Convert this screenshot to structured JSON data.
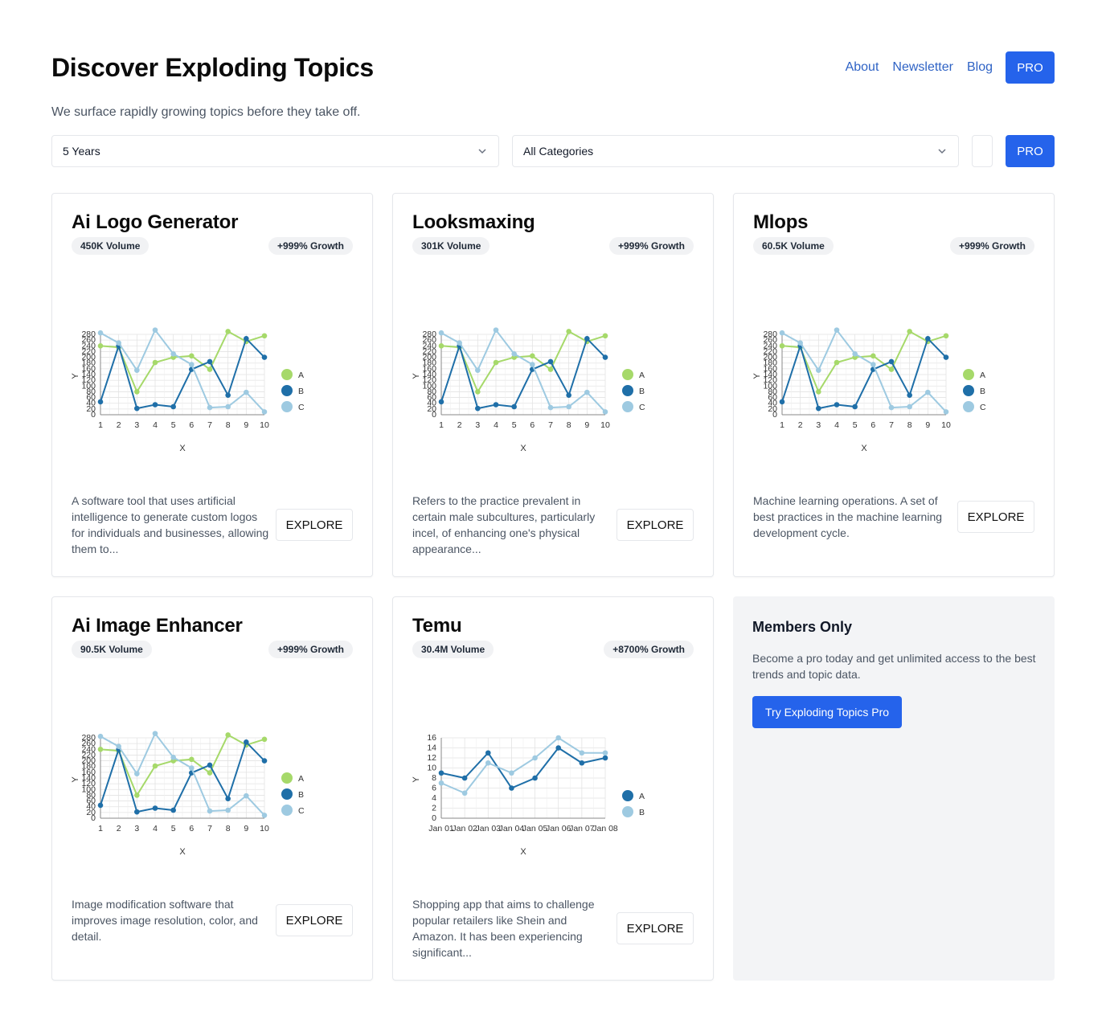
{
  "header": {
    "title": "Discover Exploding Topics",
    "subtitle": "We surface rapidly growing topics before they take off.",
    "nav": [
      "About",
      "Newsletter",
      "Blog"
    ],
    "pro_label": "PRO"
  },
  "filters": {
    "timeframe": "5 Years",
    "category": "All Categories",
    "pro_label": "PRO"
  },
  "explore_label": "EXPLORE",
  "cards": [
    {
      "title": "Ai Logo Generator",
      "volume": "450K Volume",
      "growth": "+999% Growth",
      "description": "A software tool that uses artificial intelligence to generate custom logos for individuals and businesses, allowing them to..."
    },
    {
      "title": "Looksmaxing",
      "volume": "301K Volume",
      "growth": "+999% Growth",
      "description": "Refers to the practice prevalent in certain male subcultures, particularly incel, of enhancing one's physical appearance..."
    },
    {
      "title": "Mlops",
      "volume": "60.5K Volume",
      "growth": "+999% Growth",
      "description": "Machine learning operations. A set of best practices in the machine learning development cycle."
    },
    {
      "title": "Ai Image Enhancer",
      "volume": "90.5K Volume",
      "growth": "+999% Growth",
      "description": "Image modification software that improves image resolution, color, and detail."
    },
    {
      "title": "Temu",
      "volume": "30.4M Volume",
      "growth": "+8700% Growth",
      "description": "Shopping app that aims to challenge popular retailers like Shein and Amazon. It has been experiencing significant..."
    }
  ],
  "members": {
    "title": "Members Only",
    "text": "Become a pro today and get unlimited access to the best trends and topic data.",
    "button": "Try Exploding Topics Pro"
  },
  "colors": {
    "accent": "#2563eb",
    "link": "#2f63c5",
    "series_a": "#a6d96a",
    "series_b": "#1f6fa8",
    "series_c": "#9ecae1"
  },
  "chart_data": [
    {
      "type": "line",
      "xlabel": "X",
      "ylabel": "Y",
      "x": [
        1,
        2,
        3,
        4,
        5,
        6,
        7,
        8,
        9,
        10
      ],
      "ylim": [
        0,
        280
      ],
      "yticks": [
        0,
        20,
        40,
        60,
        80,
        100,
        120,
        140,
        160,
        180,
        200,
        220,
        240,
        260,
        280
      ],
      "series": [
        {
          "name": "A",
          "values": [
            240,
            235,
            80,
            182,
            200,
            205,
            158,
            290,
            255,
            275
          ]
        },
        {
          "name": "B",
          "values": [
            45,
            240,
            22,
            35,
            28,
            158,
            185,
            68,
            265,
            200
          ]
        },
        {
          "name": "C",
          "values": [
            285,
            250,
            155,
            295,
            212,
            175,
            25,
            28,
            78,
            10
          ]
        }
      ]
    },
    {
      "type": "line",
      "xlabel": "X",
      "ylabel": "Y",
      "x": [
        1,
        2,
        3,
        4,
        5,
        6,
        7,
        8,
        9,
        10
      ],
      "ylim": [
        0,
        280
      ],
      "yticks": [
        0,
        20,
        40,
        60,
        80,
        100,
        120,
        140,
        160,
        180,
        200,
        220,
        240,
        260,
        280
      ],
      "series": [
        {
          "name": "A",
          "values": [
            240,
            235,
            80,
            182,
            200,
            205,
            158,
            290,
            255,
            275
          ]
        },
        {
          "name": "B",
          "values": [
            45,
            240,
            22,
            35,
            28,
            158,
            185,
            68,
            265,
            200
          ]
        },
        {
          "name": "C",
          "values": [
            285,
            250,
            155,
            295,
            212,
            175,
            25,
            28,
            78,
            10
          ]
        }
      ]
    },
    {
      "type": "line",
      "xlabel": "X",
      "ylabel": "Y",
      "x": [
        1,
        2,
        3,
        4,
        5,
        6,
        7,
        8,
        9,
        10
      ],
      "ylim": [
        0,
        280
      ],
      "yticks": [
        0,
        20,
        40,
        60,
        80,
        100,
        120,
        140,
        160,
        180,
        200,
        220,
        240,
        260,
        280
      ],
      "series": [
        {
          "name": "A",
          "values": [
            240,
            235,
            80,
            182,
            200,
            205,
            158,
            290,
            255,
            275
          ]
        },
        {
          "name": "B",
          "values": [
            45,
            240,
            22,
            35,
            28,
            158,
            185,
            68,
            265,
            200
          ]
        },
        {
          "name": "C",
          "values": [
            285,
            250,
            155,
            295,
            212,
            175,
            25,
            28,
            78,
            10
          ]
        }
      ]
    },
    {
      "type": "line",
      "xlabel": "X",
      "ylabel": "Y",
      "x": [
        1,
        2,
        3,
        4,
        5,
        6,
        7,
        8,
        9,
        10
      ],
      "ylim": [
        0,
        280
      ],
      "yticks": [
        0,
        20,
        40,
        60,
        80,
        100,
        120,
        140,
        160,
        180,
        200,
        220,
        240,
        260,
        280
      ],
      "series": [
        {
          "name": "A",
          "values": [
            240,
            235,
            80,
            182,
            200,
            205,
            158,
            290,
            255,
            275
          ]
        },
        {
          "name": "B",
          "values": [
            45,
            240,
            22,
            35,
            28,
            158,
            185,
            68,
            265,
            200
          ]
        },
        {
          "name": "C",
          "values": [
            285,
            250,
            155,
            295,
            212,
            175,
            25,
            28,
            78,
            10
          ]
        }
      ]
    },
    {
      "type": "line",
      "xlabel": "X",
      "ylabel": "Y",
      "x": [
        "Jan 01",
        "Jan 02",
        "Jan 03",
        "Jan 04",
        "Jan 05",
        "Jan 06",
        "Jan 07",
        "Jan 08"
      ],
      "ylim": [
        0,
        16
      ],
      "yticks": [
        0,
        2,
        4,
        6,
        8,
        10,
        12,
        14,
        16
      ],
      "series": [
        {
          "name": "A",
          "values": [
            9,
            8,
            13,
            6,
            8,
            14,
            11,
            12
          ]
        },
        {
          "name": "B",
          "values": [
            7,
            5,
            11,
            9,
            12,
            16,
            13,
            13
          ]
        }
      ]
    }
  ]
}
